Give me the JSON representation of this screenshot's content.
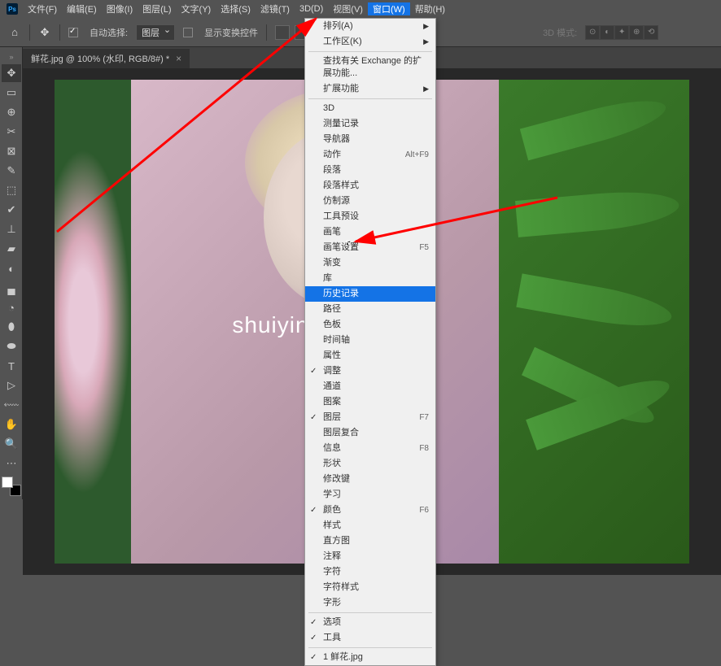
{
  "menubar": [
    "文件(F)",
    "编辑(E)",
    "图像(I)",
    "图层(L)",
    "文字(Y)",
    "选择(S)",
    "滤镜(T)",
    "3D(D)",
    "视图(V)",
    "窗口(W)",
    "帮助(H)"
  ],
  "active_menu_index": 9,
  "options": {
    "auto_select": "自动选择:",
    "layer_dropdown": "图层",
    "show_transform": "显示变换控件",
    "mode_3d": "3D 模式:"
  },
  "tab": {
    "title": "鲜花.jpg @ 100% (水印, RGB/8#) *"
  },
  "watermark": "shuiyin",
  "window_menu": {
    "section1": [
      {
        "label": "排列(A)",
        "submenu": true
      },
      {
        "label": "工作区(K)",
        "submenu": true
      }
    ],
    "section2": [
      {
        "label": "查找有关 Exchange 的扩展功能..."
      },
      {
        "label": "扩展功能",
        "submenu": true
      }
    ],
    "section3": [
      {
        "label": "3D"
      },
      {
        "label": "测量记录"
      },
      {
        "label": "导航器"
      },
      {
        "label": "动作",
        "shortcut": "Alt+F9"
      },
      {
        "label": "段落"
      },
      {
        "label": "段落样式"
      },
      {
        "label": "仿制源"
      },
      {
        "label": "工具预设"
      },
      {
        "label": "画笔"
      },
      {
        "label": "画笔设置",
        "shortcut": "F5"
      },
      {
        "label": "渐变"
      },
      {
        "label": "库"
      },
      {
        "label": "历史记录",
        "highlighted": true
      },
      {
        "label": "路径"
      },
      {
        "label": "色板"
      },
      {
        "label": "时间轴"
      },
      {
        "label": "属性"
      },
      {
        "label": "调整",
        "checked": true
      },
      {
        "label": "通道"
      },
      {
        "label": "图案"
      },
      {
        "label": "图层",
        "checked": true,
        "shortcut": "F7"
      },
      {
        "label": "图层复合"
      },
      {
        "label": "信息",
        "shortcut": "F8"
      },
      {
        "label": "形状"
      },
      {
        "label": "修改键"
      },
      {
        "label": "学习"
      },
      {
        "label": "颜色",
        "checked": true,
        "shortcut": "F6"
      },
      {
        "label": "样式"
      },
      {
        "label": "直方图"
      },
      {
        "label": "注释"
      },
      {
        "label": "字符"
      },
      {
        "label": "字符样式"
      },
      {
        "label": "字形"
      }
    ],
    "section4": [
      {
        "label": "选项",
        "checked": true
      },
      {
        "label": "工具",
        "checked": true
      }
    ],
    "section5": [
      {
        "label": "1 鲜花.jpg",
        "checked": true
      }
    ]
  },
  "tools": [
    "✥",
    "▭",
    "⊕",
    "✂",
    "⊠",
    "✎",
    "⬚",
    "✔",
    "⊥",
    "▰",
    "◐",
    "▄",
    "◔",
    "⬮",
    "⬬",
    "T",
    "▷",
    "⬳",
    "✋",
    "🔍"
  ],
  "selected_tool_index": 0
}
